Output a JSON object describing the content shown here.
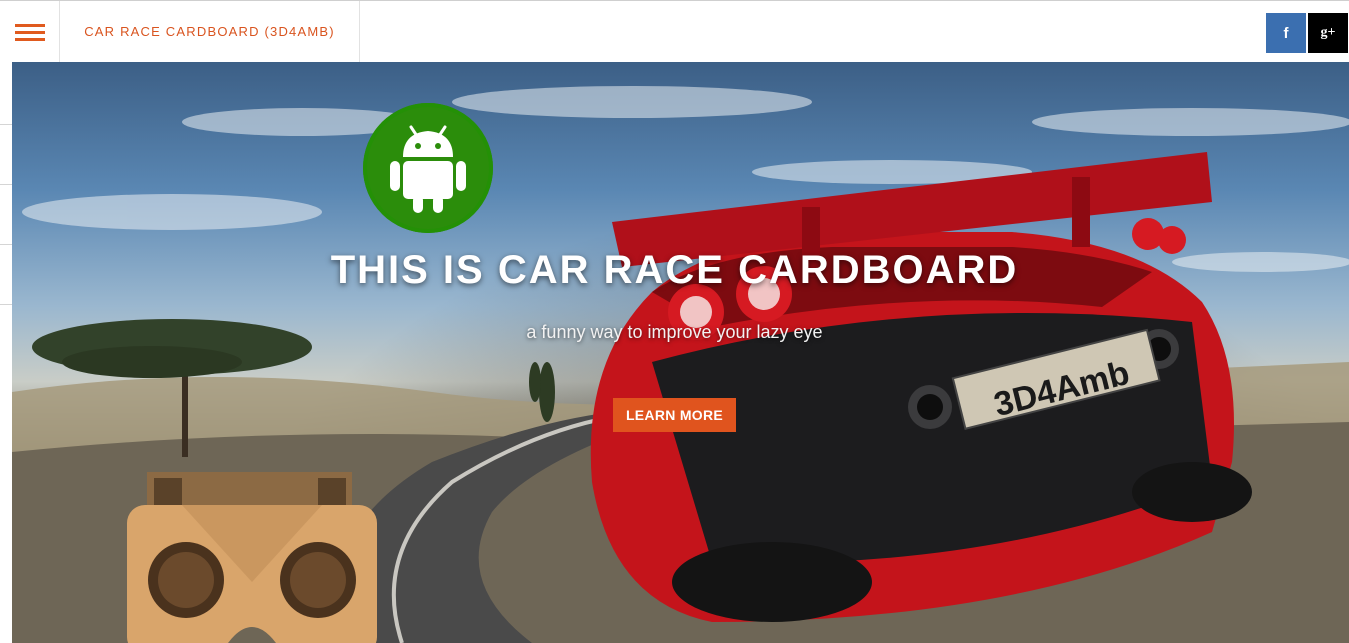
{
  "header": {
    "title": "CAR RACE CARDBOARD (3D4AMB)",
    "menu_icon": "hamburger-menu-icon",
    "social": {
      "facebook_label": "f",
      "googleplus_label": "g+"
    }
  },
  "hero": {
    "badge_icon": "android-icon",
    "title": "THIS IS CAR RACE CARDBOARD",
    "subtitle": "a funny way to improve your lazy eye",
    "cta_label": "LEARN MORE",
    "plate_text": "3D4Amb"
  },
  "colors": {
    "accent": "#e0541e",
    "facebook": "#3b6fb0",
    "googleplus": "#000000",
    "android_green": "#2b8d0b",
    "car_red": "#c4141b"
  }
}
